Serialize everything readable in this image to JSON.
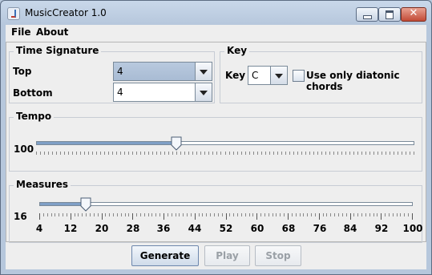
{
  "window": {
    "title": "MusicCreator 1.0"
  },
  "menu": {
    "file": "File",
    "about": "About"
  },
  "time_signature": {
    "title": "Time Signature",
    "top_label": "Top",
    "top_value": "4",
    "bottom_label": "Bottom",
    "bottom_value": "4"
  },
  "key": {
    "title": "Key",
    "label": "Key",
    "value": "C",
    "diatonic_label": "Use only diatonic chords",
    "diatonic_checked": false
  },
  "tempo": {
    "title": "Tempo",
    "value": "100",
    "level_fraction": 0.37
  },
  "measures": {
    "title": "Measures",
    "value": "16",
    "min": 4,
    "max": 100,
    "tick_labels": [
      "4",
      "12",
      "20",
      "28",
      "36",
      "44",
      "52",
      "60",
      "68",
      "76",
      "84",
      "92",
      "100"
    ]
  },
  "buttons": {
    "generate": "Generate",
    "play": "Play",
    "stop": "Stop"
  },
  "colors": {
    "titlebar": "#c9d8ea",
    "panel": "#eeeeee",
    "slider_fill": "#7f9fc6",
    "close_button": "#c24a36"
  }
}
